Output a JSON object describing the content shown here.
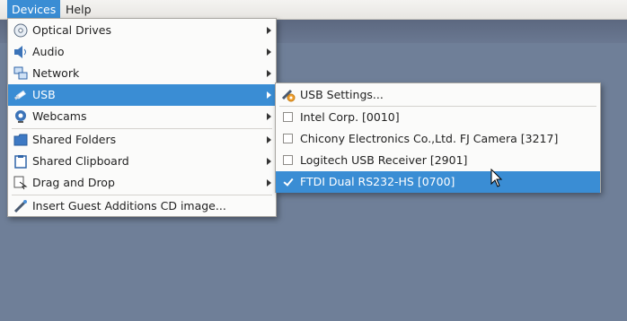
{
  "menubar": {
    "items": [
      {
        "label": "Devices",
        "active": true
      },
      {
        "label": "Help",
        "active": false
      }
    ]
  },
  "devices_menu": {
    "items": [
      {
        "label": "Optical Drives",
        "icon": "optical-disc-icon",
        "submenu": true
      },
      {
        "label": "Audio",
        "icon": "audio-icon",
        "submenu": true
      },
      {
        "label": "Network",
        "icon": "network-icon",
        "submenu": true
      },
      {
        "label": "USB",
        "icon": "usb-icon",
        "submenu": true,
        "highlighted": true
      },
      {
        "label": "Webcams",
        "icon": "webcam-icon",
        "submenu": true
      },
      {
        "label": "Shared Folders",
        "icon": "folder-icon",
        "submenu": true
      },
      {
        "label": "Shared Clipboard",
        "icon": "clipboard-icon",
        "submenu": true
      },
      {
        "label": "Drag and Drop",
        "icon": "drag-drop-icon",
        "submenu": true
      },
      {
        "label": "Insert Guest Additions CD image...",
        "icon": "guest-additions-icon",
        "submenu": false
      }
    ]
  },
  "usb_menu": {
    "settings_label": "USB Settings...",
    "devices": [
      {
        "label": "Intel Corp.  [0010]",
        "checked": false
      },
      {
        "label": "Chicony Electronics Co.,Ltd. FJ Camera [3217]",
        "checked": false
      },
      {
        "label": "Logitech USB Receiver [2901]",
        "checked": false
      },
      {
        "label": "FTDI Dual RS232-HS [0700]",
        "checked": true,
        "highlighted": true
      }
    ]
  },
  "colors": {
    "highlight": "#3a8dd4",
    "desktop": "#6f7f98"
  }
}
